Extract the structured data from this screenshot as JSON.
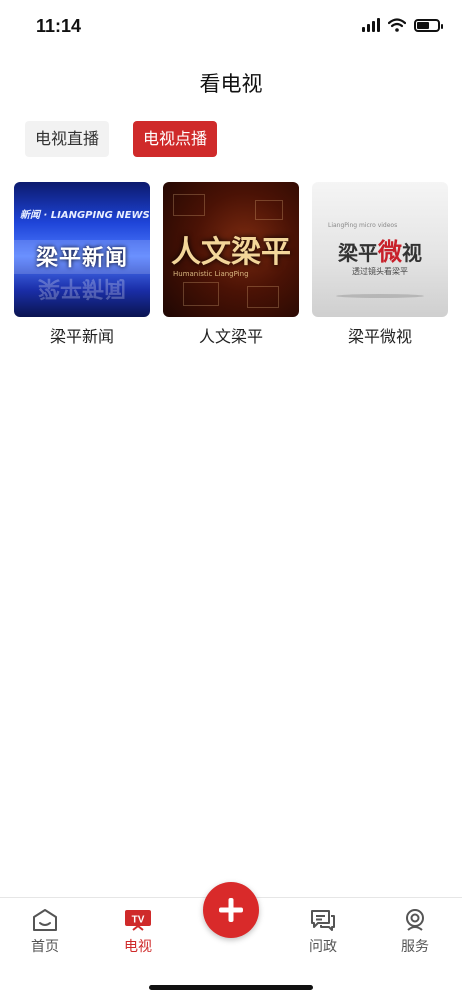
{
  "status_bar": {
    "time": "11:14",
    "battery_level_percent": 60
  },
  "header": {
    "title": "看电视"
  },
  "tabs": [
    {
      "label": "电视直播",
      "active": false
    },
    {
      "label": "电视点播",
      "active": true
    }
  ],
  "programs": [
    {
      "title": "梁平新闻",
      "thumb_text": "梁平新闻",
      "thumb_subtext": "新闻 · LIANGPING NEWS"
    },
    {
      "title": "人文梁平",
      "thumb_text": "人文梁平",
      "thumb_subtext": "Humanistic LiangPing"
    },
    {
      "title": "梁平微视",
      "thumb_text_a": "梁平",
      "thumb_text_b": "微",
      "thumb_text_c": "视",
      "thumb_subtext": "透过镜头看梁平",
      "thumb_microtext": "LiangPing micro videos"
    }
  ],
  "tabbar": {
    "items": [
      {
        "label": "首页",
        "active": false
      },
      {
        "label": "电视",
        "active": true
      },
      {
        "label": "问政",
        "active": false
      },
      {
        "label": "服务",
        "active": false
      }
    ]
  },
  "colors": {
    "accent": "#cf2a2a",
    "fab": "#d92a2a",
    "inactive_tab_bg": "#f2f2f2"
  }
}
